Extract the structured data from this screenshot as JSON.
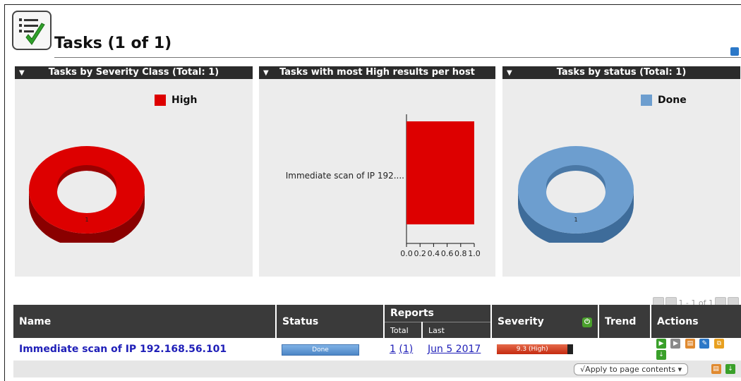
{
  "page": {
    "title": "Tasks (1 of 1)"
  },
  "panels": [
    {
      "title": "Tasks by Severity Class (Total: 1)",
      "legend": "High",
      "legend_color": "#dd0000",
      "slice_label": "1"
    },
    {
      "title": "Tasks with most High results per host",
      "bar_label": "Immediate scan of IP 192....",
      "bar_color": "#dd0000",
      "tick_labels": [
        "0.0",
        "0.2",
        "0.4",
        "0.6",
        "0.8",
        "1.0"
      ]
    },
    {
      "title": "Tasks by status (Total: 1)",
      "legend": "Done",
      "legend_color": "#6d9ecf",
      "slice_label": "1"
    }
  ],
  "chart_data": [
    {
      "type": "pie",
      "categories": [
        "High"
      ],
      "values": [
        1
      ],
      "title": "Tasks by Severity Class (Total: 1)"
    },
    {
      "type": "bar",
      "categories": [
        "Immediate scan of IP 192...."
      ],
      "values": [
        1.0
      ],
      "title": "Tasks with most High results per host",
      "xlim": [
        0,
        1
      ]
    },
    {
      "type": "pie",
      "categories": [
        "Done"
      ],
      "values": [
        1
      ],
      "title": "Tasks by status (Total: 1)"
    }
  ],
  "pagination": {
    "text": "1 - 1 of 1"
  },
  "table": {
    "headers": {
      "name": "Name",
      "status": "Status",
      "reports": "Reports",
      "total": "Total",
      "last": "Last",
      "severity": "Severity",
      "trend": "Trend",
      "actions": "Actions"
    },
    "rows": [
      {
        "name": "Immediate scan of IP 192.168.56.101",
        "status": "Done",
        "status_progress": 1.0,
        "reports_total": "1",
        "reports_total_paren": "(1)",
        "reports_last": "Jun 5 2017",
        "severity": "9.3 (High)",
        "severity_value": 9.3
      }
    ],
    "footer": {
      "apply_label": "√Apply to page contents ▾"
    }
  },
  "colors": {
    "high": "#dd0000",
    "done": "#6d9ecf",
    "header_dark": "#2b2b2b",
    "link": "#1f1fb8"
  }
}
